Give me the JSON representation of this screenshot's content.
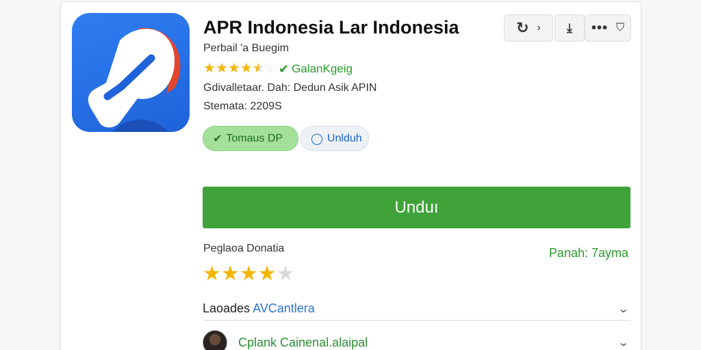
{
  "app": {
    "title": "APR Indonesia Lar Indonesia",
    "subtitle": "Perbail 'a Buegim",
    "rating_text": "GalanKgeig",
    "rating_stars": 4.5,
    "info_line_1": "Gdivalletaar. Dah: Dedun Asik APIN",
    "info_line_2": "Stemata: 2209S"
  },
  "chips": {
    "installed_label": "Tomaus DP",
    "update_label": "Unlduh"
  },
  "toolbar": {
    "refresh_icon": "refresh-icon",
    "forward_icon": "chevron-right-icon",
    "download_icon": "download-icon",
    "more_icon": "more-icon",
    "shield_icon": "shield-icon"
  },
  "download_button": {
    "label": "Unduı"
  },
  "reviews": {
    "label": "Peglaoa Donatia",
    "right_text": "Panah: 7ayma",
    "stars": 4
  },
  "rows": [
    {
      "label_plain": "Laoades ",
      "label_accent": "AVCantlera"
    },
    {
      "label": "Cplank Cainenal.alaipal"
    }
  ],
  "colors": {
    "accent_green": "#3fa33a",
    "accent_blue": "#1f62da",
    "star": "#f2b600"
  }
}
